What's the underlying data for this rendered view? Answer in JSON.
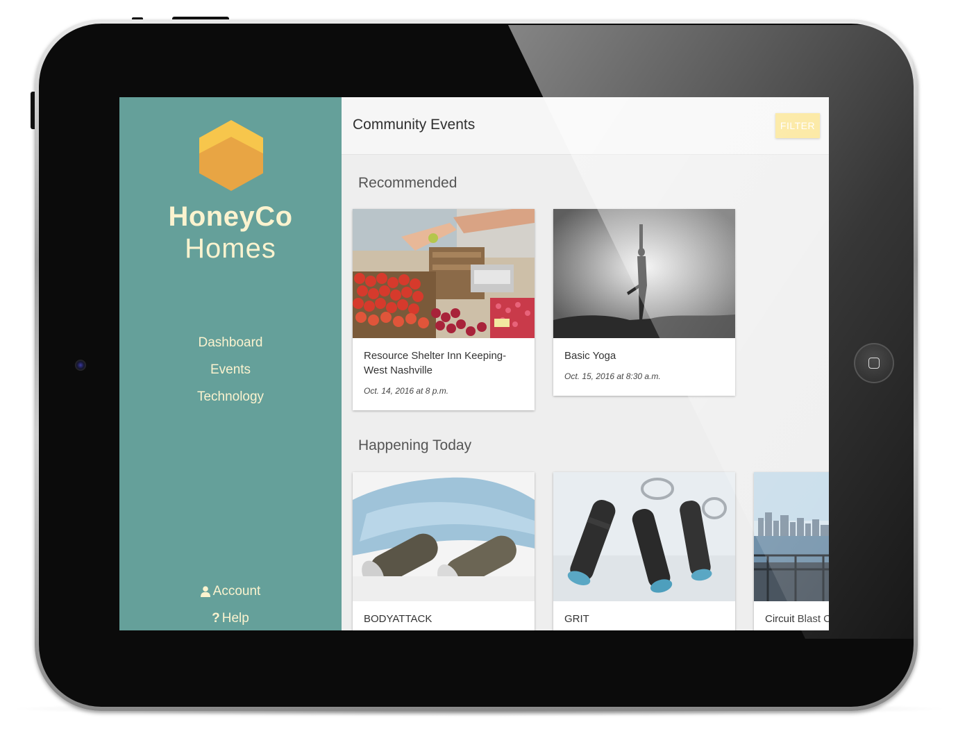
{
  "brand": {
    "line1": "HoneyCo",
    "line2": "Homes"
  },
  "colors": {
    "sidebar": "#65a09a",
    "brand_text": "#fbf3cf",
    "accent_button": "#fbe38a",
    "hex_top": "#f7c64c",
    "hex_bottom": "#e8a544"
  },
  "nav": {
    "items": [
      {
        "label": "Dashboard"
      },
      {
        "label": "Events"
      },
      {
        "label": "Technology"
      }
    ],
    "footer": [
      {
        "label": "Account",
        "icon": "user-icon"
      },
      {
        "label": "Help",
        "icon": "question-icon",
        "glyph": "?"
      }
    ]
  },
  "header": {
    "title": "Community Events",
    "filter_label": "FILTER"
  },
  "sections": {
    "recommended": {
      "title": "Recommended",
      "cards": [
        {
          "title": "Resource Shelter Inn Keeping-West Nashville",
          "date": "Oct. 14, 2016 at 8 p.m.",
          "image": "farmers-market-photo"
        },
        {
          "title": "Basic Yoga",
          "date": "Oct. 15, 2016 at 8:30 a.m.",
          "image": "yoga-silhouette-photo"
        }
      ]
    },
    "today": {
      "title": "Happening Today",
      "cards": [
        {
          "title": "BODYATTACK",
          "image": "dumbbells-towel-photo"
        },
        {
          "title": "GRIT",
          "image": "hand-grippers-photo"
        },
        {
          "title": "Circuit Blast C",
          "image": "city-skyline-photo"
        }
      ]
    }
  }
}
